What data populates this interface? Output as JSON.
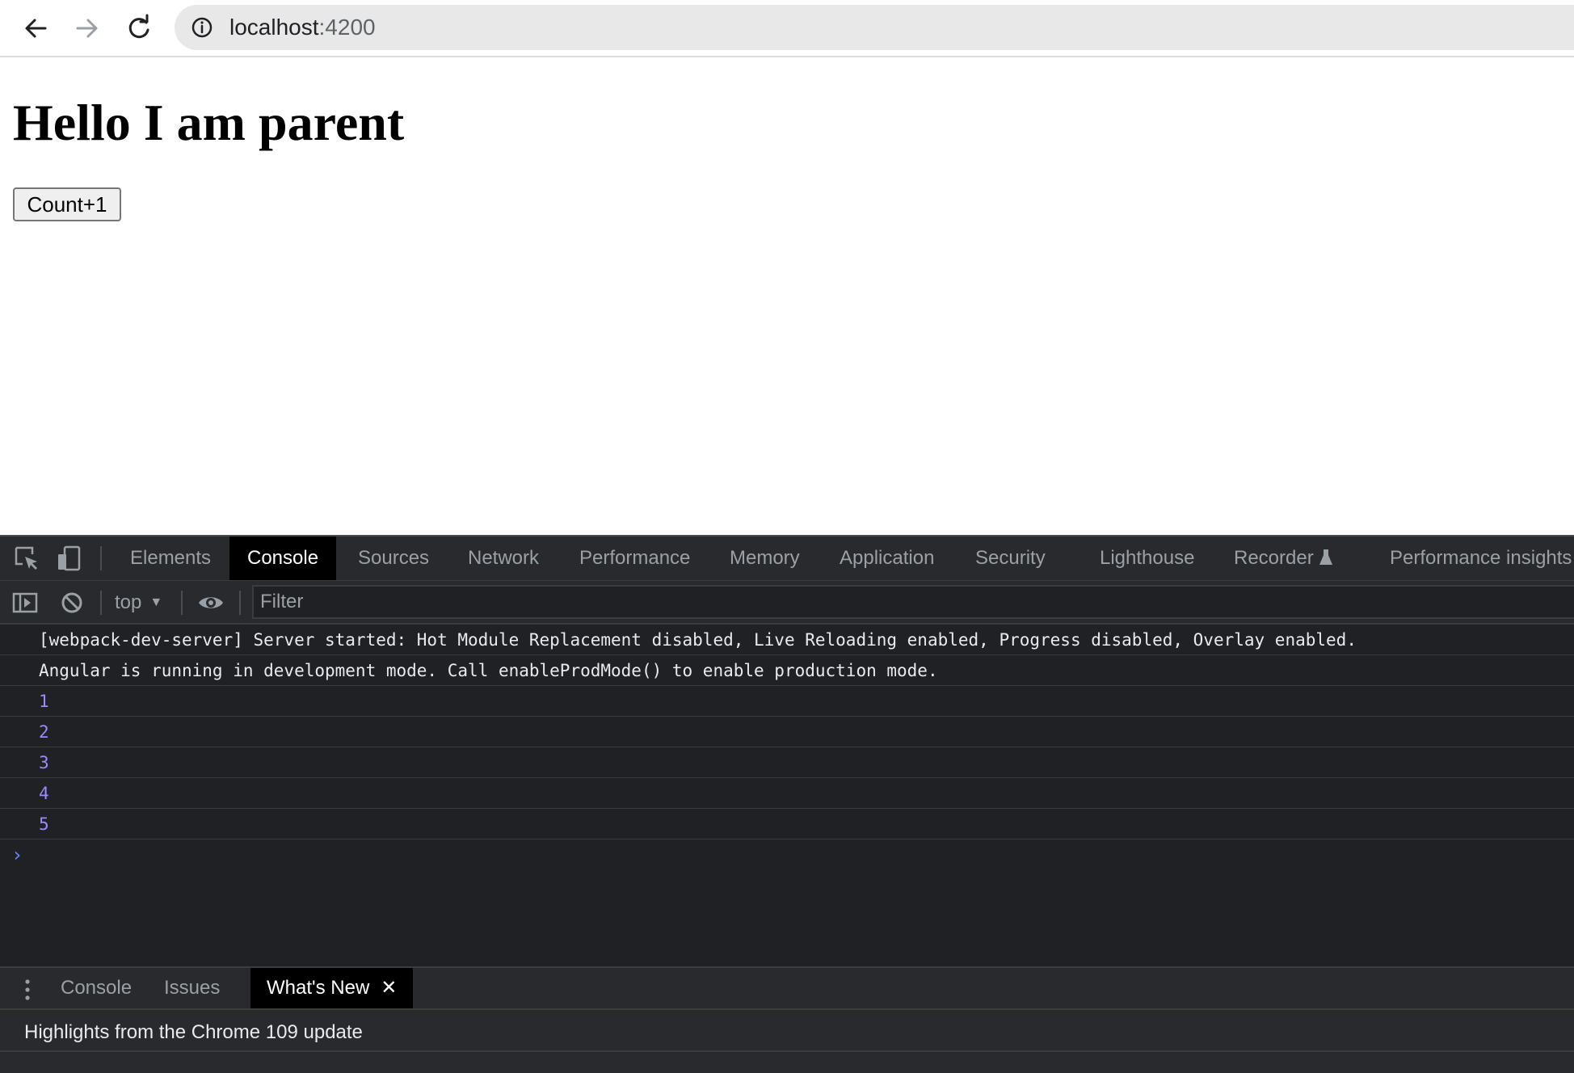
{
  "browser": {
    "url_host": "localhost",
    "url_port": ":4200",
    "icons": {
      "back": "arrow-left-icon",
      "forward": "arrow-right-icon",
      "reload": "reload-icon",
      "site_info": "info-circle-icon"
    }
  },
  "page": {
    "heading": "Hello I am parent",
    "button_label": "Count+1"
  },
  "devtools": {
    "tabs": [
      "Elements",
      "Console",
      "Sources",
      "Network",
      "Performance",
      "Memory",
      "Application",
      "Security",
      "Lighthouse",
      "Recorder",
      "Performance insights"
    ],
    "active_tab": "Console",
    "console_toolbar": {
      "context": "top",
      "filter_placeholder": "Filter"
    },
    "console_messages": [
      "[webpack-dev-server] Server started: Hot Module Replacement disabled, Live Reloading enabled, Progress disabled, Overlay enabled.",
      "Angular is running in development mode. Call enableProdMode() to enable production mode.",
      "1",
      "2",
      "3",
      "4",
      "5"
    ],
    "prompt_symbol": "›",
    "drawer": {
      "tabs": [
        "Console",
        "Issues",
        "What's New"
      ],
      "active_tab": "What's New",
      "close_symbol": "✕",
      "content_text": "Highlights from the Chrome 109 update"
    },
    "colors": {
      "panel_bg": "#202124",
      "toolbar_bg": "#292a2d",
      "number_log": "#9a8cff",
      "prompt": "#5b8cf7"
    }
  }
}
